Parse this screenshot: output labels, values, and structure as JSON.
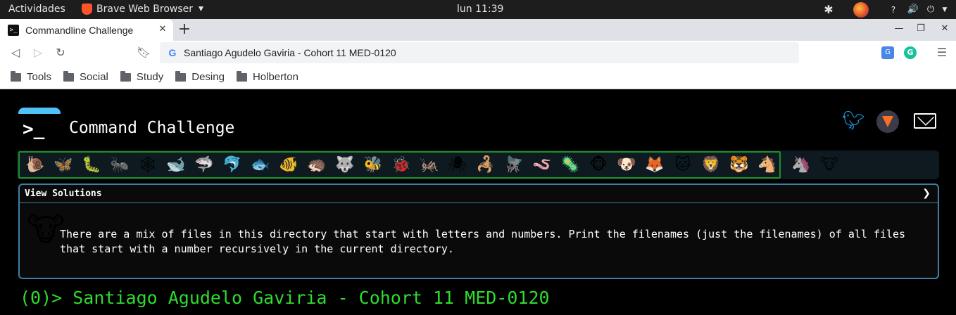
{
  "topbar": {
    "activities": "Actividades",
    "app_name": "Brave Web Browser",
    "clock": "lun 11:39"
  },
  "browser": {
    "tab_title": "Commandline Challenge",
    "omnibox_text": "Santiago Agudelo Gaviria - Cohort 11 MED-0120",
    "bookmarks": [
      "Tools",
      "Social",
      "Study",
      "Desing",
      "Holberton"
    ]
  },
  "page": {
    "logo_glyph": ">_",
    "title": "Command Challenge",
    "levels": [
      {
        "icon": "snail",
        "glyph": "🐌",
        "done": true
      },
      {
        "icon": "butterfly",
        "glyph": "🦋",
        "done": true
      },
      {
        "icon": "caterpillar",
        "glyph": "🐛",
        "done": true
      },
      {
        "icon": "ant",
        "glyph": "🐜",
        "done": true
      },
      {
        "icon": "spider-web",
        "glyph": "🕸",
        "done": true
      },
      {
        "icon": "whale",
        "glyph": "🐋",
        "done": true
      },
      {
        "icon": "shark",
        "glyph": "🦈",
        "done": true
      },
      {
        "icon": "dolphin",
        "glyph": "🐬",
        "done": true
      },
      {
        "icon": "fish",
        "glyph": "🐟",
        "done": true
      },
      {
        "icon": "tropical-fish",
        "glyph": "🐠",
        "done": true
      },
      {
        "icon": "hedgehog",
        "glyph": "🦔",
        "done": true
      },
      {
        "icon": "wolf",
        "glyph": "🐺",
        "done": true
      },
      {
        "icon": "bee",
        "glyph": "🐝",
        "done": true
      },
      {
        "icon": "ladybug",
        "glyph": "🐞",
        "done": true
      },
      {
        "icon": "cricket",
        "glyph": "🦗",
        "done": true
      },
      {
        "icon": "spider",
        "glyph": "🕷",
        "done": true
      },
      {
        "icon": "scorpion",
        "glyph": "🦂",
        "done": true
      },
      {
        "icon": "fly",
        "glyph": "🪰",
        "done": true
      },
      {
        "icon": "worm",
        "glyph": "🪱",
        "done": true
      },
      {
        "icon": "microbe",
        "glyph": "🦠",
        "done": true
      },
      {
        "icon": "monkey",
        "glyph": "🐵",
        "done": true
      },
      {
        "icon": "dog",
        "glyph": "🐶",
        "done": true
      },
      {
        "icon": "fox",
        "glyph": "🦊",
        "done": true
      },
      {
        "icon": "cat",
        "glyph": "🐱",
        "done": true
      },
      {
        "icon": "lion",
        "glyph": "🦁",
        "done": true
      },
      {
        "icon": "tiger",
        "glyph": "🐯",
        "done": true
      },
      {
        "icon": "horse",
        "glyph": "🐴",
        "done": true
      },
      {
        "icon": "unicorn",
        "glyph": "🦄",
        "done": false
      },
      {
        "icon": "cow",
        "glyph": "🐮",
        "done": false
      }
    ],
    "solutions_label": "View Solutions",
    "challenge_icon": "cow",
    "challenge_glyph": "🐮",
    "challenge_text": "There are a mix of files in this directory that start with letters and numbers. Print the filenames (just the filenames) of all files that start with a number recursively in the current directory.",
    "terminal_prompt": "(0)> Santiago Agudelo Gaviria - Cohort 11 MED-0120"
  }
}
